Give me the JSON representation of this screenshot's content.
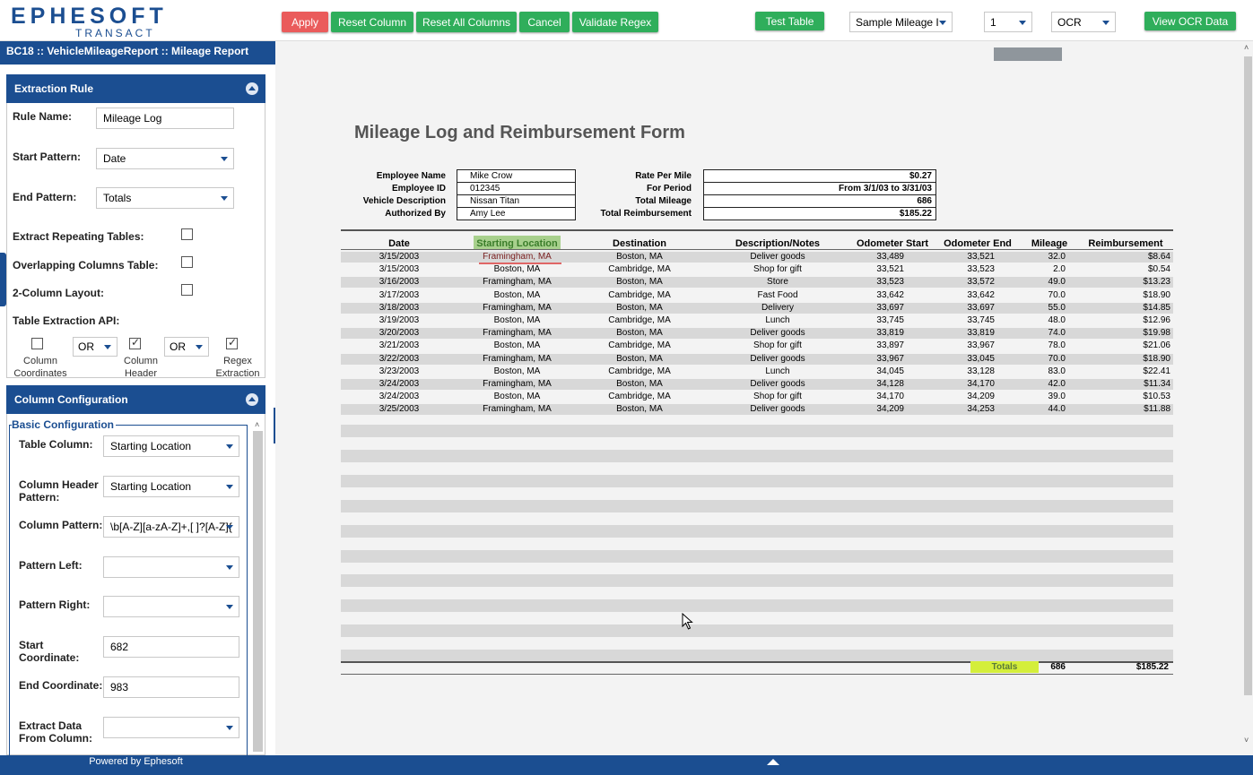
{
  "header": {
    "logo_main": "EPHESOFT",
    "logo_sub": "TRANSACT",
    "buttons": {
      "apply": "Apply",
      "reset_column": "Reset Column",
      "reset_all_columns": "Reset All Columns",
      "cancel": "Cancel",
      "validate_regex": "Validate Regex",
      "test_table": "Test Table",
      "view_ocr_data": "View OCR Data"
    },
    "sample_select": "Sample Mileage I",
    "page_select": "1",
    "mode_select": "OCR"
  },
  "breadcrumb": "BC18 :: VehicleMileageReport :: Mileage Report",
  "extraction_rule": {
    "title": "Extraction Rule",
    "rule_name_label": "Rule Name:",
    "rule_name": "Mileage Log",
    "start_pattern_label": "Start Pattern:",
    "start_pattern": "Date",
    "end_pattern_label": "End Pattern:",
    "end_pattern": "Totals",
    "extract_repeating_label": "Extract Repeating Tables:",
    "overlapping_label": "Overlapping Columns Table:",
    "two_column_label": "2-Column Layout:",
    "api_label": "Table Extraction API:",
    "op1": "OR",
    "op2": "OR",
    "column_coordinates_label": "Column\nCoordinates",
    "column_header_label": "Column\nHeader",
    "regex_extraction_label": "Regex\nExtraction"
  },
  "column_configuration": {
    "title": "Column Configuration",
    "basic_legend": "Basic Configuration",
    "table_column_label": "Table Column:",
    "table_column": "Starting Location",
    "header_pattern_label": "Column Header\nPattern:",
    "header_pattern": "Starting Location",
    "column_pattern_label": "Column Pattern:",
    "column_pattern": "\\b[A-Z][a-zA-Z]+,[ ]?[A-Z]{",
    "pattern_left_label": "Pattern Left:",
    "pattern_right_label": "Pattern Right:",
    "start_coord_label": "Start\nCoordinate:",
    "start_coord": "682",
    "end_coord_label": "End Coordinate:",
    "end_coord": "983",
    "extract_from_label": "Extract Data\nFrom Column:"
  },
  "footer": "Powered by Ephesoft",
  "document": {
    "title": "Mileage Log and Reimbursement Form",
    "left_fields": [
      {
        "label": "Employee Name",
        "value": "Mike Crow"
      },
      {
        "label": "Employee ID",
        "value": "012345"
      },
      {
        "label": "Vehicle Description",
        "value": "Nissan Titan"
      },
      {
        "label": "Authorized By",
        "value": "Amy Lee"
      }
    ],
    "right_fields": [
      {
        "label": "Rate Per Mile",
        "value": "$0.27"
      },
      {
        "label": "For Period",
        "value": "From 3/1/03 to 3/31/03"
      },
      {
        "label": "Total Mileage",
        "value": "686"
      },
      {
        "label": "Total Reimbursement",
        "value": "$185.22"
      }
    ],
    "columns": [
      "Date",
      "Starting Location",
      "Destination",
      "Description/Notes",
      "Odometer Start",
      "Odometer End",
      "Mileage",
      "Reimbursement"
    ],
    "rows": [
      [
        "3/15/2003",
        "Framingham, MA",
        "Boston, MA",
        "Deliver goods",
        "33,489",
        "33,521",
        "32.0",
        "$8.64"
      ],
      [
        "3/15/2003",
        "Boston, MA",
        "Cambridge, MA",
        "Shop for gift",
        "33,521",
        "33,523",
        "2.0",
        "$0.54"
      ],
      [
        "3/16/2003",
        "Framingham, MA",
        "Boston, MA",
        "Store",
        "33,523",
        "33,572",
        "49.0",
        "$13.23"
      ],
      [
        "3/17/2003",
        "Boston, MA",
        "Cambridge, MA",
        "Fast Food",
        "33,642",
        "33,642",
        "70.0",
        "$18.90"
      ],
      [
        "3/18/2003",
        "Framingham, MA",
        "Boston, MA",
        "Delivery",
        "33,697",
        "33,697",
        "55.0",
        "$14.85"
      ],
      [
        "3/19/2003",
        "Boston, MA",
        "Cambridge, MA",
        "Lunch",
        "33,745",
        "33,745",
        "48.0",
        "$12.96"
      ],
      [
        "3/20/2003",
        "Framingham, MA",
        "Boston, MA",
        "Deliver goods",
        "33,819",
        "33,819",
        "74.0",
        "$19.98"
      ],
      [
        "3/21/2003",
        "Boston, MA",
        "Cambridge, MA",
        "Shop for gift",
        "33,897",
        "33,967",
        "78.0",
        "$21.06"
      ],
      [
        "3/22/2003",
        "Framingham, MA",
        "Boston, MA",
        "Deliver goods",
        "33,967",
        "33,045",
        "70.0",
        "$18.90"
      ],
      [
        "3/23/2003",
        "Boston, MA",
        "Cambridge, MA",
        "Lunch",
        "34,045",
        "33,128",
        "83.0",
        "$22.41"
      ],
      [
        "3/24/2003",
        "Framingham, MA",
        "Boston, MA",
        "Deliver goods",
        "34,128",
        "34,170",
        "42.0",
        "$11.34"
      ],
      [
        "3/24/2003",
        "Boston, MA",
        "Cambridge, MA",
        "Shop for gift",
        "34,170",
        "34,209",
        "39.0",
        "$10.53"
      ],
      [
        "3/25/2003",
        "Framingham, MA",
        "Boston, MA",
        "Deliver goods",
        "34,209",
        "34,253",
        "44.0",
        "$11.88"
      ]
    ],
    "totals_label": "Totals",
    "totals_mileage": "686",
    "totals_reimbursement": "$185.22"
  },
  "colors": {
    "brand": "#1b4e91",
    "button_green": "#2fae5b",
    "button_red": "#ea5b5b",
    "header_highlight": "#a8d08d",
    "cell_highlight": "#e06666",
    "totals_highlight": "#d4ee3a"
  }
}
